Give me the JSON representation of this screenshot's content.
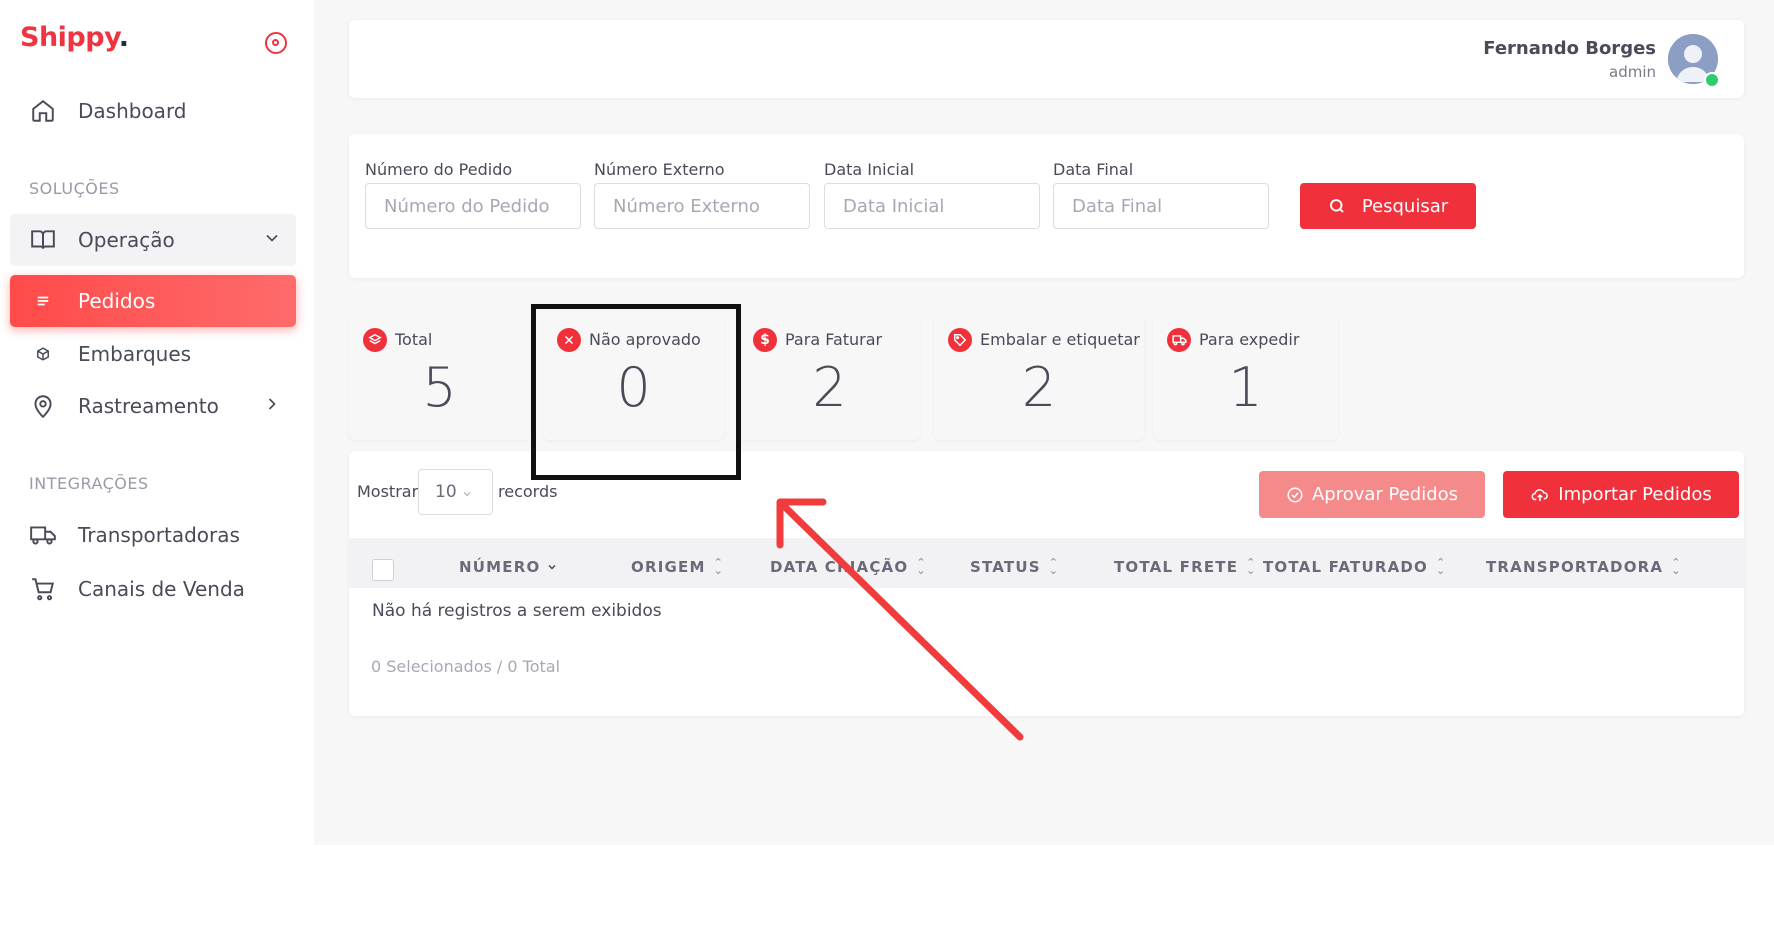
{
  "brand": {
    "name": "Shippy",
    "dot": "."
  },
  "sidebar": {
    "dashboard": "Dashboard",
    "section_solucoes": "SOLUÇÕES",
    "operacao": "Operação",
    "pedidos": "Pedidos",
    "embarques": "Embarques",
    "rastreamento": "Rastreamento",
    "section_integracoes": "INTEGRAÇÕES",
    "transportadoras": "Transportadoras",
    "canais": "Canais de Venda"
  },
  "header": {
    "user_name": "Fernando Borges",
    "user_role": "admin"
  },
  "filters": {
    "numero_pedido_label": "Número do Pedido",
    "numero_pedido_placeholder": "Número do Pedido",
    "numero_externo_label": "Número Externo",
    "numero_externo_placeholder": "Número Externo",
    "data_inicial_label": "Data Inicial",
    "data_inicial_placeholder": "Data Inicial",
    "data_final_label": "Data Final",
    "data_final_placeholder": "Data Final",
    "search_button": "Pesquisar"
  },
  "stats": [
    {
      "label": "Total",
      "value": "5",
      "icon": "layers-icon"
    },
    {
      "label": "Não aprovado",
      "value": "0",
      "icon": "x-icon"
    },
    {
      "label": "Para Faturar",
      "value": "2",
      "icon": "dollar-icon"
    },
    {
      "label": "Embalar e etiquetar",
      "value": "2",
      "icon": "tag-icon"
    },
    {
      "label": "Para expedir",
      "value": "1",
      "icon": "truck-icon"
    }
  ],
  "table": {
    "show_label": "Mostrar",
    "page_size": "10",
    "records_label": "records",
    "approve_button": "Aprovar Pedidos",
    "import_button": "Importar Pedidos",
    "columns": [
      "NÚMERO",
      "ORIGEM",
      "DATA CRIAÇÃO",
      "STATUS",
      "TOTAL FRETE",
      "TOTAL FATURADO",
      "TRANSPORTADORA"
    ],
    "empty_message": "Não há registros a serem exibidos",
    "selection_summary": "0 Selecionados / 0 Total"
  },
  "colors": {
    "accent": "#f0303a",
    "annotation": "#f03c3c"
  }
}
